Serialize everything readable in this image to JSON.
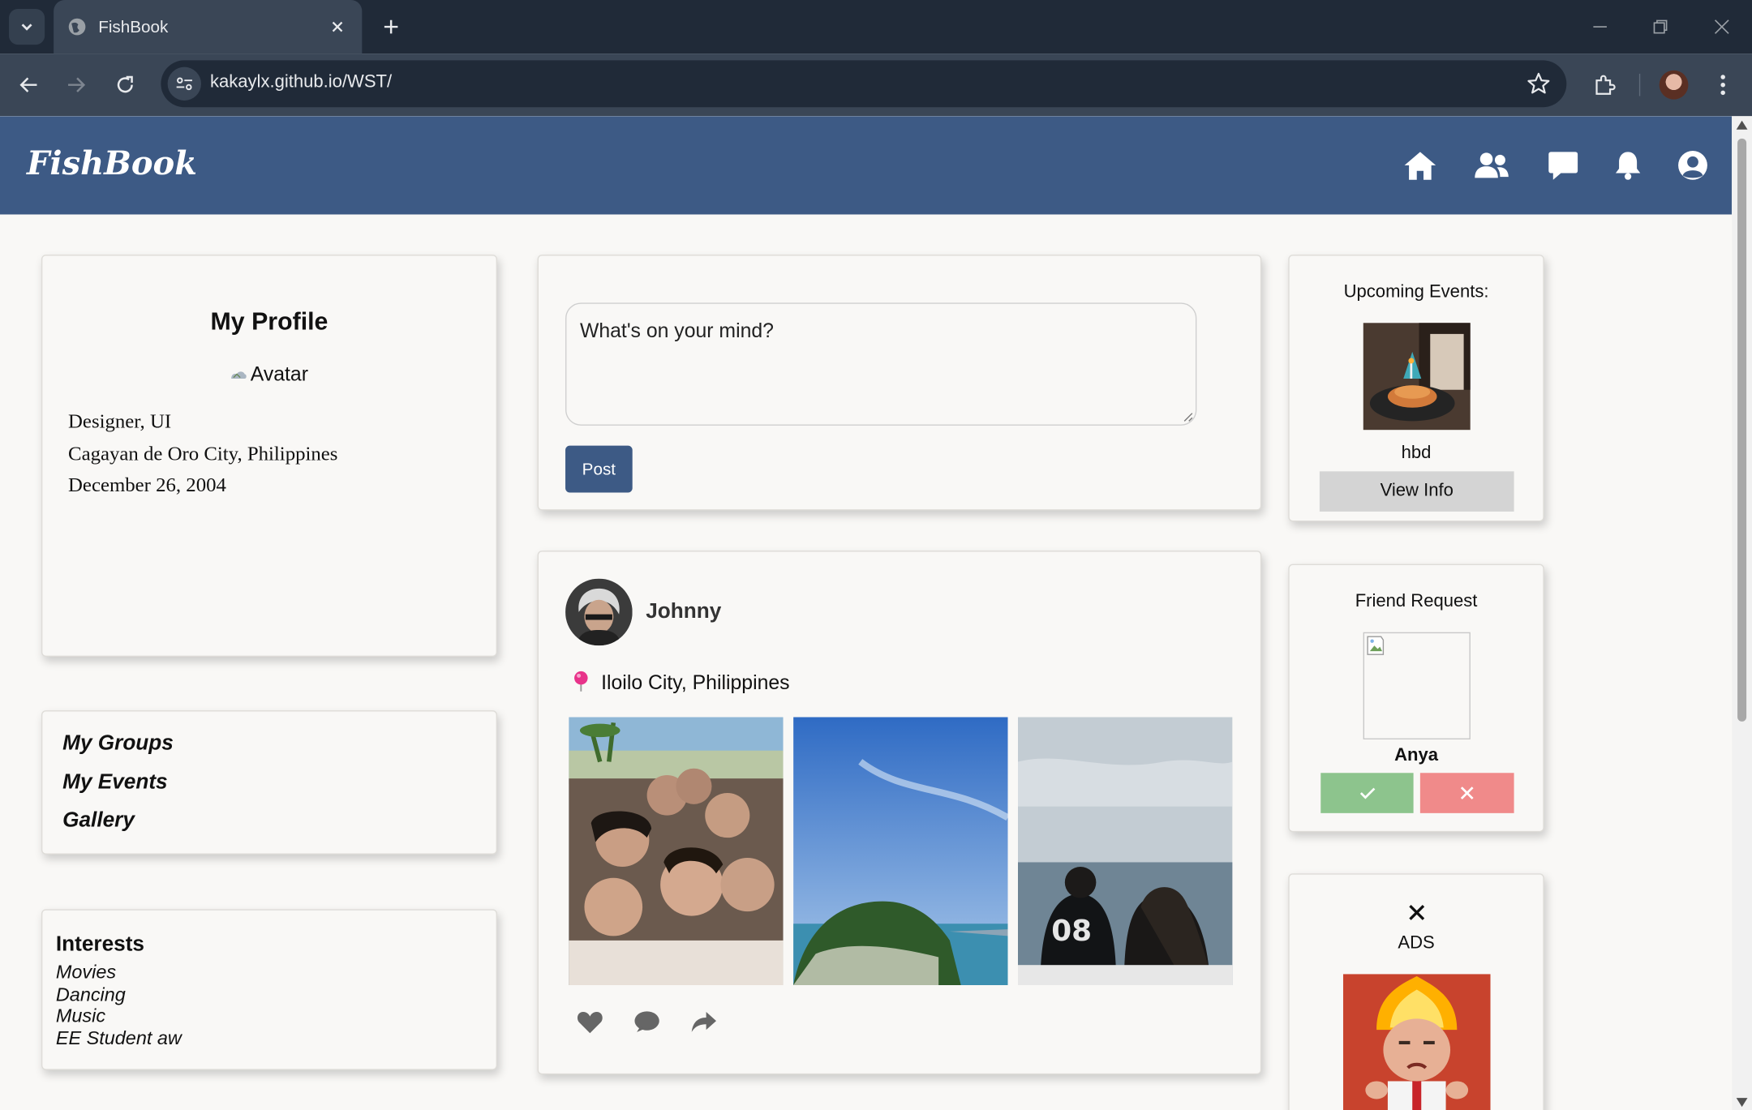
{
  "browser": {
    "tab_title": "FishBook",
    "url": "kakaylx.github.io/WST/"
  },
  "header": {
    "logo": "FishBook",
    "nav_icons": [
      "home-icon",
      "friends-icon",
      "messages-icon",
      "notifications-icon",
      "account-icon"
    ],
    "background": "#3d5a85"
  },
  "profile": {
    "title": "My Profile",
    "avatar_alt": "Avatar",
    "role": "Designer, UI",
    "location": "Cagayan de Oro City, Philippines",
    "birthday": "December 26, 2004"
  },
  "menu": {
    "items": [
      "My Groups",
      "My Events",
      "Gallery"
    ]
  },
  "interests": {
    "title": "Interests",
    "items": [
      "Movies",
      "Dancing",
      "Music",
      "EE Student aw"
    ]
  },
  "composer": {
    "placeholder": "What's on your mind?",
    "post_label": "Post"
  },
  "post": {
    "author": "Johnny",
    "location": "Iloilo City, Philippines",
    "photos": [
      "group-selfie-photo",
      "island-photo",
      "ocean-view-photo"
    ],
    "actions": [
      "heart-icon",
      "comment-icon",
      "share-icon"
    ]
  },
  "events": {
    "title": "Upcoming Events:",
    "event_name": "hbd",
    "button": "View Info"
  },
  "friend_request": {
    "title": "Friend Request",
    "name": "Anya",
    "accept_color": "#8dc48d",
    "decline_color": "#f08a8a"
  },
  "ads": {
    "label": "ADS"
  }
}
